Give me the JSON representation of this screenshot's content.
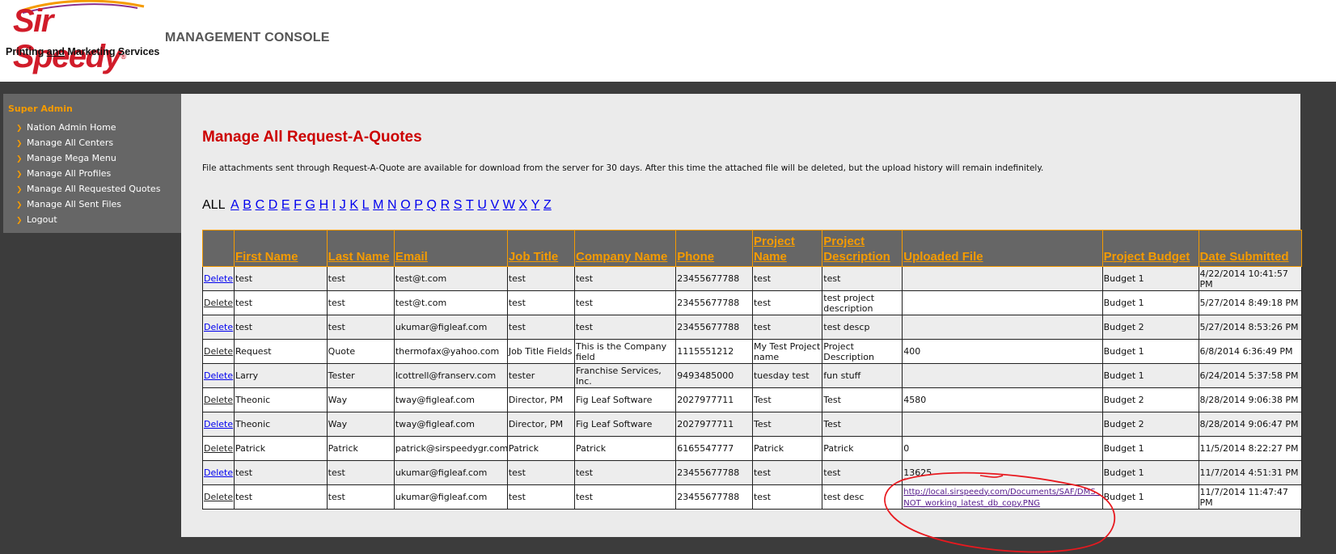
{
  "header": {
    "logo_text": "Sir Speedy",
    "logo_reg": "®",
    "tagline_part1": "Printing ",
    "tagline_and": "and",
    "tagline_part2": " Marketing Services",
    "console_title": "MANAGEMENT CONSOLE"
  },
  "sidebar": {
    "title": "Super Admin",
    "items": [
      "Nation Admin Home",
      "Manage All Centers",
      "Manage Mega Menu",
      "Manage All Profiles",
      "Manage All Requested Quotes",
      "Manage All Sent Files",
      "Logout"
    ]
  },
  "main": {
    "title": "Manage All Request-A-Quotes",
    "notice": "File attachments sent through Request-A-Quote are available for download from the server for 30 days. After this time the attached file will be deleted, but the upload history will remain indefinitely.",
    "alpha_all": "ALL",
    "letters": [
      "A",
      "B",
      "C",
      "D",
      "E",
      "F",
      "G",
      "H",
      "I",
      "J",
      "K",
      "L",
      "M",
      "N",
      "O",
      "P",
      "Q",
      "R",
      "S",
      "T",
      "U",
      "V",
      "W",
      "X",
      "Y",
      "Z"
    ]
  },
  "table": {
    "columns": [
      "",
      "First Name",
      "Last Name",
      "Email",
      "Job Title",
      "Company Name",
      "Phone",
      "Project Name",
      "Project Description",
      "Uploaded File",
      "Project Budget",
      "Date Submitted"
    ],
    "delete_label": "Delete",
    "rows": [
      {
        "first": "test",
        "last": "test",
        "email": "test@t.com",
        "job": "test",
        "company": "test",
        "phone": "23455677788",
        "project": "test",
        "desc": "test",
        "file": "",
        "budget": "Budget 1",
        "date": "4/22/2014 10:41:57 PM"
      },
      {
        "first": "test",
        "last": "test",
        "email": "test@t.com",
        "job": "test",
        "company": "test",
        "phone": "23455677788",
        "project": "test",
        "desc": "test project description",
        "file": "",
        "budget": "Budget 1",
        "date": "5/27/2014 8:49:18 PM"
      },
      {
        "first": "test",
        "last": "test",
        "email": "ukumar@figleaf.com",
        "job": "test",
        "company": "test",
        "phone": "23455677788",
        "project": "test",
        "desc": "test descp",
        "file": "",
        "budget": "Budget 2",
        "date": "5/27/2014 8:53:26 PM"
      },
      {
        "first": "Request",
        "last": "Quote",
        "email": "thermofax@yahoo.com",
        "job": "Job Title Fields",
        "company": "This is the Company field",
        "phone": "1115551212",
        "project": "My Test Project name",
        "desc": "Project Description",
        "file": "400",
        "budget": "Budget 1",
        "date": "6/8/2014 6:36:49 PM"
      },
      {
        "first": "Larry",
        "last": "Tester",
        "email": "lcottrell@franserv.com",
        "job": "tester",
        "company": "Franchise Services, Inc.",
        "phone": "9493485000",
        "project": "tuesday test",
        "desc": "fun stuff",
        "file": "",
        "budget": "Budget 1",
        "date": "6/24/2014 5:37:58 PM"
      },
      {
        "first": "Theonic",
        "last": "Way",
        "email": "tway@figleaf.com",
        "job": "Director, PM",
        "company": "Fig Leaf Software",
        "phone": "2027977711",
        "project": "Test",
        "desc": "Test",
        "file": "4580",
        "budget": "Budget 2",
        "date": "8/28/2014 9:06:38 PM"
      },
      {
        "first": "Theonic",
        "last": "Way",
        "email": "tway@figleaf.com",
        "job": "Director, PM",
        "company": "Fig Leaf Software",
        "phone": "2027977711",
        "project": "Test",
        "desc": "Test",
        "file": "",
        "budget": "Budget 2",
        "date": "8/28/2014 9:06:47 PM"
      },
      {
        "first": "Patrick",
        "last": "Patrick",
        "email": "patrick@sirspeedygr.com",
        "job": "Patrick",
        "company": "Patrick",
        "phone": "6165547777",
        "project": "Patrick",
        "desc": "Patrick",
        "file": "0",
        "budget": "Budget 1",
        "date": "11/5/2014 8:22:27 PM"
      },
      {
        "first": "test",
        "last": "test",
        "email": "ukumar@figleaf.com",
        "job": "test",
        "company": "test",
        "phone": "23455677788",
        "project": "test",
        "desc": "test",
        "file": "13625",
        "budget": "Budget 1",
        "date": "11/7/2014 4:51:31 PM"
      },
      {
        "first": "test",
        "last": "test",
        "email": "ukumar@figleaf.com",
        "job": "test",
        "company": "test",
        "phone": "23455677788",
        "project": "test",
        "desc": "test desc",
        "file": "",
        "file_link": "http://local.sirspeedy.com/Documents/SAF/DMS_NOT_working_latest_db_copy.PNG",
        "budget": "Budget 1",
        "date": "11/7/2014 11:47:47 PM"
      }
    ]
  },
  "colors": {
    "accent": "#f59b00",
    "title_red": "#cc0000",
    "sidebar_bg": "#666666",
    "frame_bg": "#3c3c3c",
    "content_bg": "#ebebeb",
    "annotation_red": "#e8191f"
  },
  "icons": {
    "sidebar_bullet": "chevron-right-icon"
  }
}
